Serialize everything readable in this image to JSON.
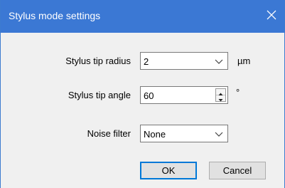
{
  "window": {
    "title": "Stylus mode settings",
    "close_icon": "close-icon"
  },
  "fields": {
    "tip_radius": {
      "label": "Stylus tip radius",
      "value": "2",
      "unit": "µm"
    },
    "tip_angle": {
      "label": "Stylus tip angle",
      "value": "60",
      "unit": "°"
    },
    "noise_filter": {
      "label": "Noise filter",
      "value": "None"
    }
  },
  "buttons": {
    "ok": "OK",
    "cancel": "Cancel"
  },
  "colors": {
    "titlebar": "#3b78d4",
    "dialog_bg": "#f0f0f0",
    "accent": "#0078d7"
  }
}
